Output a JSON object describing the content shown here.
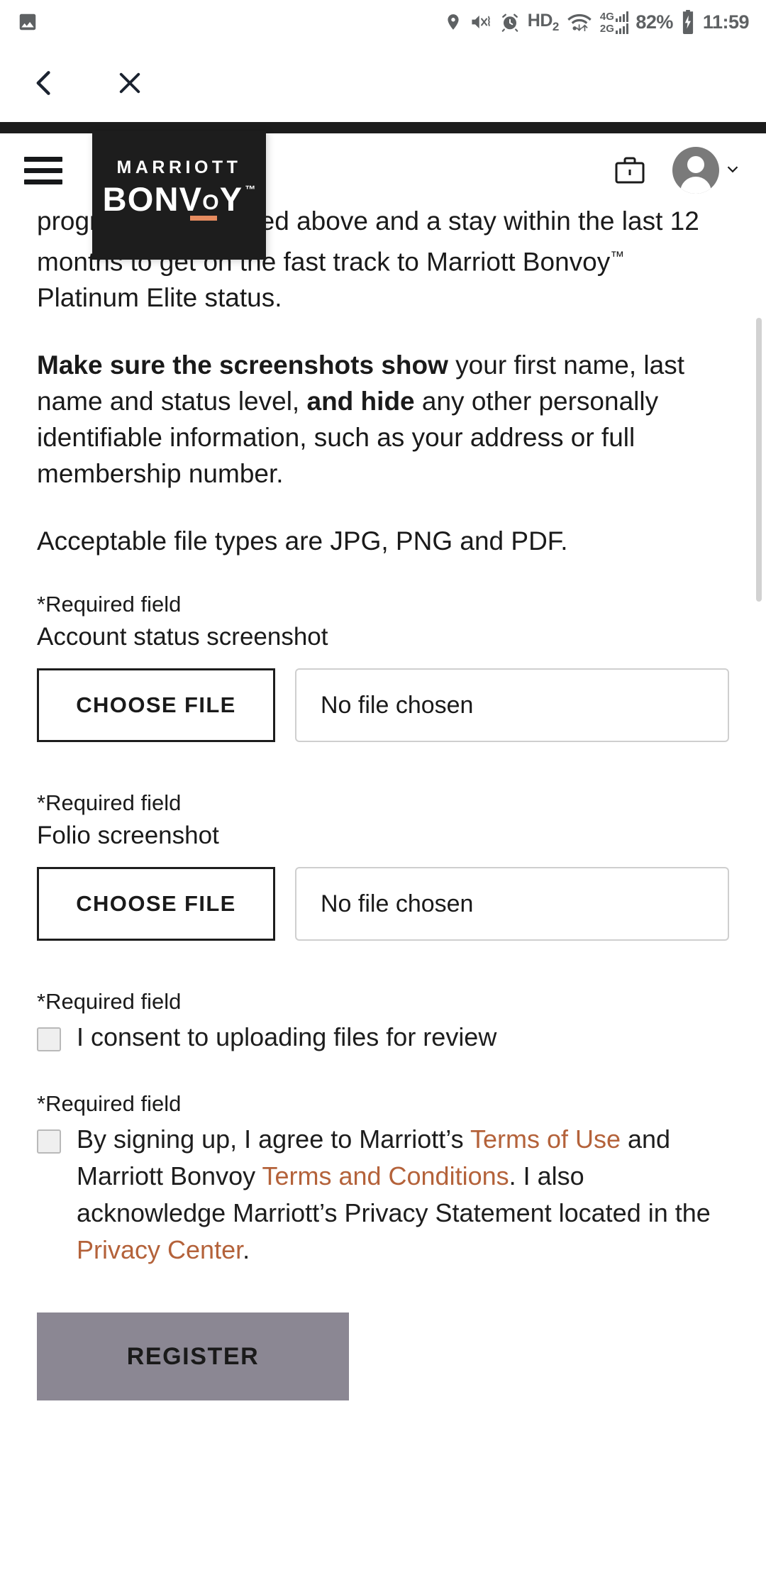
{
  "statusbar": {
    "gallery_icon": "image-icon",
    "location_icon": "location-pin-icon",
    "mute_icon": "volume-mute-vibrate-icon",
    "alarm_icon": "alarm-clock-icon",
    "hd_label": "HD",
    "hd_sub": "2",
    "wifi_icon": "wifi-icon",
    "sim1_label": "4G",
    "sim2_label": "2G",
    "battery_percent": "82%",
    "battery_icon": "battery-charging-icon",
    "time": "11:59"
  },
  "browserbar": {
    "back_icon": "back-chevron-icon",
    "close_icon": "close-x-icon"
  },
  "header": {
    "menu_icon": "hamburger-menu-icon",
    "briefcase_icon": "briefcase-icon",
    "account_icon": "account-avatar-icon",
    "chevron_icon": "chevron-down-icon",
    "logo": {
      "line1": "MARRIOTT",
      "bonvoy_pre": "BONV",
      "bonvoy_o": "O",
      "bonvoy_post": "Y",
      "tm": "™"
    }
  },
  "content": {
    "paragraph1_prefix": "",
    "paragraph1": "program you selected above and a stay within the last 12 months to get on the fast track to Marriott Bonvoy",
    "paragraph1_tm": "™",
    "paragraph1_suffix": " Platinum Elite status.",
    "paragraph2_bold1": "Make sure the screenshots show",
    "paragraph2_mid1": " your first name, last name and status level, ",
    "paragraph2_bold2": "and hide",
    "paragraph2_mid2": " any other personally identifiable information, such as your address or full membership number.",
    "paragraph3": "Acceptable file types are JPG, PNG and PDF.",
    "field1": {
      "required_label": "*Required field",
      "title": "Account status screenshot",
      "button_label": "CHOOSE FILE",
      "file_status": "No file chosen"
    },
    "field2": {
      "required_label": "*Required field",
      "title": "Folio screenshot",
      "button_label": "CHOOSE FILE",
      "file_status": "No file chosen"
    },
    "consent1": {
      "required_label": "*Required field",
      "text": "I consent to uploading files for review"
    },
    "consent2": {
      "required_label": "*Required field",
      "text_part1": "By signing up, I agree to Marriott’s ",
      "link1": "Terms of Use",
      "text_part2": " and Marriott Bonvoy ",
      "link2": "Terms and Conditions",
      "text_part3": ". I also acknowledge Marriott’s Privacy Statement located in the ",
      "link3": "Privacy Center",
      "text_part4": "."
    },
    "register_label": "REGISTER"
  },
  "colors": {
    "accent_orange": "#b4623a",
    "logo_underline": "#e58b5f",
    "header_dark": "#1d1d1d",
    "register_disabled": "#8b8793"
  }
}
